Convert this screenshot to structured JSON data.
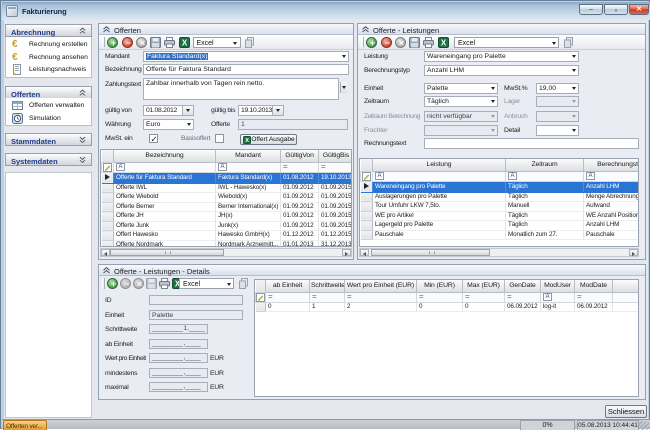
{
  "window": {
    "title": "Fakturierung",
    "controls": {
      "minimize": "–",
      "maximize": "▫",
      "close": "✕"
    }
  },
  "sidebar": {
    "sections": [
      {
        "label": "Abrechnung",
        "expanded": true,
        "items": [
          {
            "icon": "euro-icon",
            "label": "Rechnung erstellen"
          },
          {
            "icon": "euro-icon",
            "label": "Rechnung ansehen"
          },
          {
            "icon": "document-icon",
            "label": "Leistungsnachweis"
          }
        ]
      },
      {
        "label": "Offerten",
        "expanded": true,
        "items": [
          {
            "icon": "grid-icon",
            "label": "Offerten verwalten"
          },
          {
            "icon": "clock-icon",
            "label": "Simulation"
          }
        ]
      },
      {
        "label": "Stammdaten",
        "expanded": false,
        "items": []
      },
      {
        "label": "Systemdaten",
        "expanded": false,
        "items": []
      }
    ]
  },
  "panels": {
    "offerten": {
      "title": "Offerten",
      "toolbar": {
        "export_combo": "Excel"
      },
      "form": {
        "mandant_label": "Mandant",
        "mandant_value": "Faktura Standard(x)",
        "bezeichnung_label": "Bezeichnung",
        "bezeichnung_value": "Offerte für Faktura Standard",
        "zahlungstext_label": "Zahlungstext",
        "zahlungstext_value": "Zahlbar innerhalb von  Tagen rein netto.",
        "gueltig_von_label": "gültig von",
        "gueltig_von_value": "01.08.2012",
        "gueltig_bis_label": "gültig bis",
        "gueltig_bis_value": "19.10.2013",
        "waehrung_label": "Währung",
        "waehrung_value": "Euro",
        "offerte_label": "Offerte",
        "offerte_value": "1",
        "mwst_label": "MwSt. ein",
        "mwst_checked": true,
        "basisoffert_label": "Basisoffert",
        "basisoffert_checked": false,
        "offert_ausgabe_label": "Offert Ausgabe"
      },
      "table": {
        "columns": [
          "Bezeichnung",
          "Mandant",
          "GültigVon",
          "GültigBis"
        ],
        "selected_index": 0,
        "rows": [
          [
            "Offerte für Faktura Standard",
            "Faktura Standard(x)",
            "01.08.2012",
            "19.10.2013"
          ],
          [
            "Offerte IWL",
            "IWL - Hawesko(x)",
            "01.09.2012",
            "01.09.2015"
          ],
          [
            "Offerte Wiebold",
            "Wiebold(x)",
            "01.09.2012",
            "01.09.2015"
          ],
          [
            "Offerte Berner",
            "Berner International(x)",
            "01.09.2012",
            "01.09.2015"
          ],
          [
            "Offerte JH",
            "JH(x)",
            "01.09.2012",
            "01.09.2015"
          ],
          [
            "Offerte Junk",
            "Junk(x)",
            "01.09.2012",
            "01.09.2015"
          ],
          [
            "Offert Hawesko",
            "Hawesko GmbH(x)",
            "01.12.2012",
            "01.12.2015"
          ],
          [
            "Offerte Nordmark",
            "Nordmark Arzneimitt...",
            "01.01.2013",
            "31.12.2013"
          ]
        ]
      }
    },
    "leistungen": {
      "title": "Offerte - Leistungen",
      "toolbar": {
        "export_combo": "Excel"
      },
      "form": {
        "leistung_label": "Leistung",
        "leistung_value": "Wareneingang pro Palette",
        "berechnungstyp_label": "Berechnungstyp",
        "berechnungstyp_value": "Anzahl LHM",
        "einheit_label": "Einheit",
        "einheit_value": "Palette",
        "mwst_label": "MwSt.%",
        "mwst_value": "19,00",
        "zeitraum_label": "Zeitraum",
        "zeitraum_value": "Täglich",
        "lager_label": "Lager",
        "lager_value": "",
        "zeitraum_berechnung_label": "Zeitraum Berechnung",
        "zeitraum_berechnung_value": "nicht verfügbar",
        "anbruch_label": "Anbruch",
        "anbruch_value": "",
        "frachter_label": "Frachter",
        "frachter_value": "",
        "detail_label": "Detail",
        "detail_value": "",
        "rechnungstext_label": "Rechnungstext",
        "rechnungstext_value": ""
      },
      "table": {
        "columns": [
          "Leistung",
          "Zeitraum",
          "Berechnungstyp"
        ],
        "selected_index": 0,
        "rows": [
          [
            "Wareneingang pro Palette",
            "Täglich",
            "Anzahl LHM"
          ],
          [
            "Auslagerungen pro Palette",
            "Täglich",
            "Menge Abrechnungs"
          ],
          [
            "Tour Umfuhr LKW 7,5to.",
            "Manuell",
            "Aufwand"
          ],
          [
            "WE pro Artikel",
            "Täglich",
            "WE Anzahl Positione"
          ],
          [
            "Lagergeld pro Palette",
            "Täglich",
            "Anzahl LHM"
          ],
          [
            "Pauschale",
            "Monatlich zum 27.",
            "Pauschale"
          ]
        ]
      }
    },
    "details": {
      "title": "Offerte - Leistungen - Details",
      "toolbar": {
        "export_combo": "Excel"
      },
      "form": {
        "id_label": "ID",
        "id_value": "",
        "einheit_label": "Einheit",
        "einheit_value": "Palette",
        "schrittweite_label": "Schrittweite",
        "schrittweite_value": "________1,____",
        "ab_einheit_label": "ab Einheit",
        "ab_einheit_value": "________,____",
        "wert_label": "Wert pro Einheit",
        "wert_value": "________,____",
        "wert_unit": "EUR",
        "mindestens_label": "mindestens",
        "mindestens_value": "________,____",
        "mindestens_unit": "EUR",
        "maximal_label": "maximal",
        "maximal_value": "________,____",
        "maximal_unit": "EUR"
      },
      "table": {
        "columns": [
          "ab Einheit",
          "Schrittweite",
          "Wert pro Einheit (EUR)",
          "Min (EUR)",
          "Max (EUR)",
          "GenDate",
          "ModUser",
          "ModDate"
        ],
        "selected_index": -1,
        "rows": [
          [
            "0",
            "1",
            "2",
            "0",
            "0",
            "06.09.2012",
            "log-it",
            "06.09.2012"
          ]
        ]
      }
    }
  },
  "footer": {
    "close_button": "Schliessen"
  },
  "statusbar": {
    "tab": "Offerten ver...",
    "progress": "0%",
    "timestamp": "05.08.2013 10:44:41"
  }
}
